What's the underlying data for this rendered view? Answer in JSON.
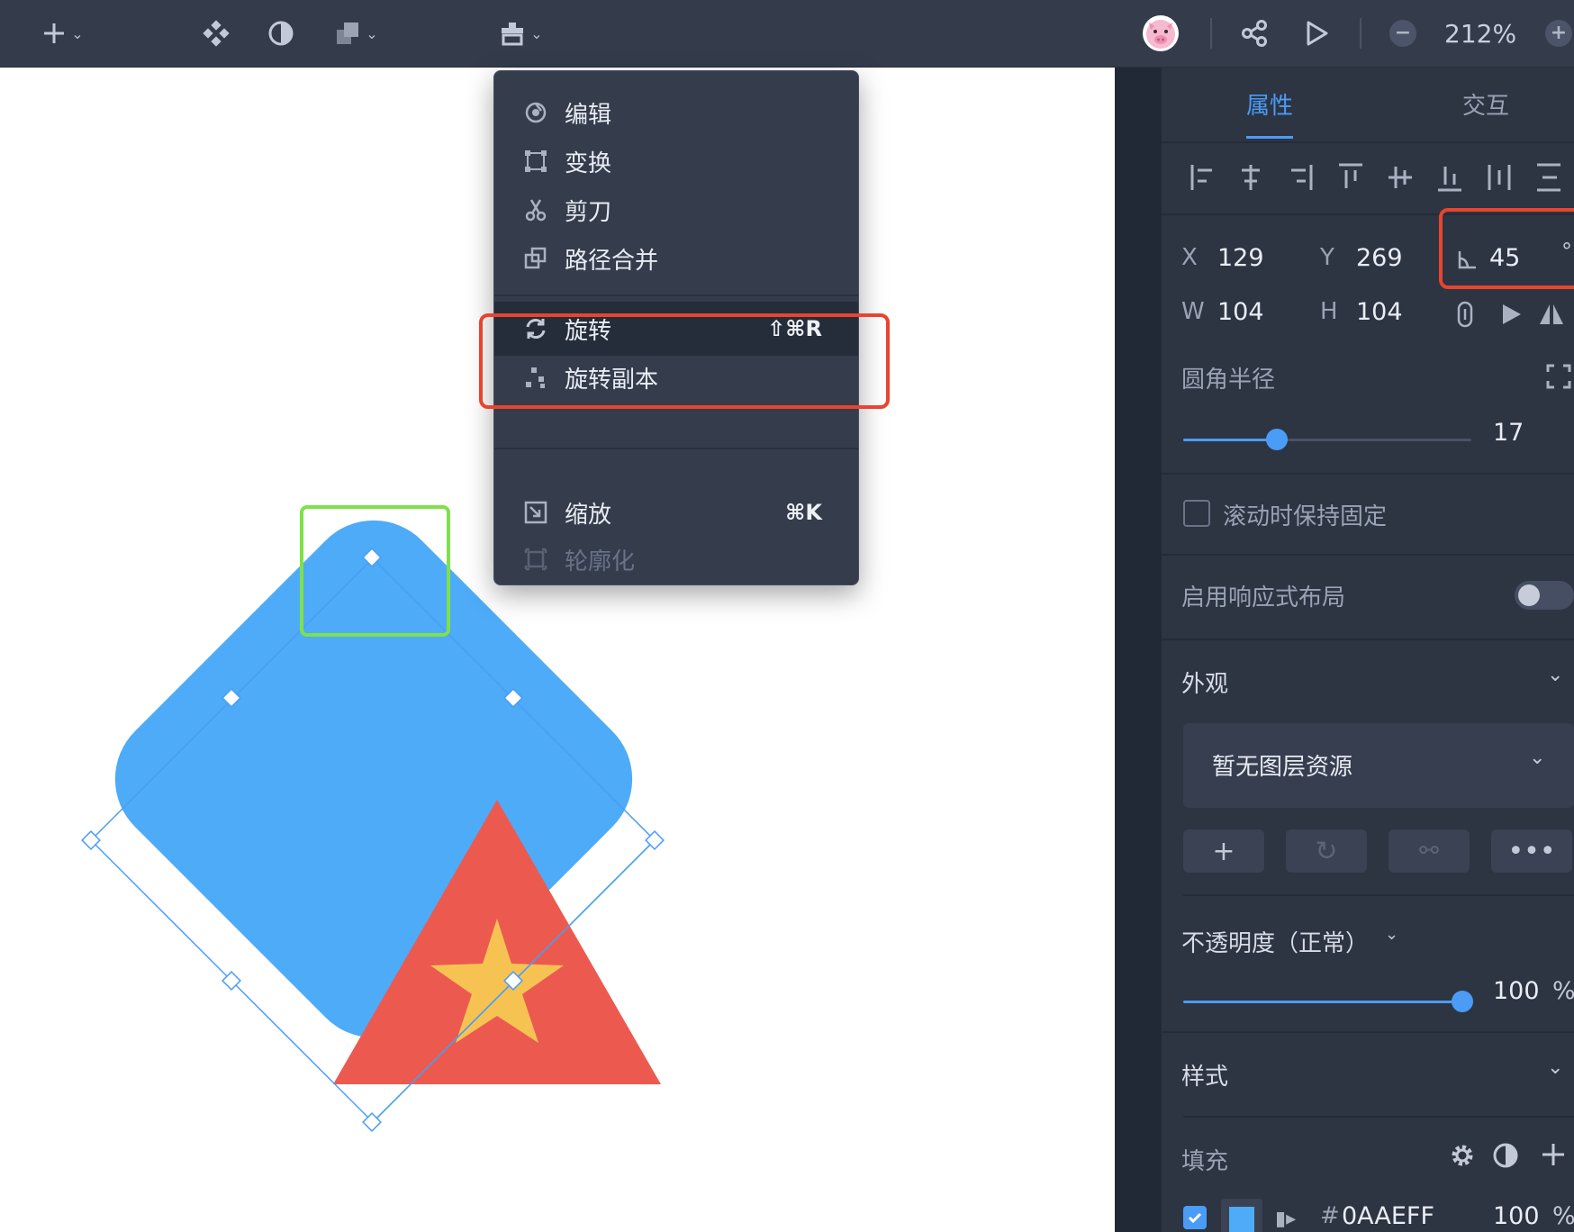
{
  "toolbar": {
    "add_icon": "plus-icon",
    "component_icon": "component-icon",
    "mask_icon": "half-circle-icon",
    "boolean_icon": "layers-icon",
    "path_tools_icon": "path-tools-icon",
    "avatar_icon": "pig-avatar",
    "share_icon": "share-icon",
    "play_icon": "play-icon",
    "zoom_out_label": "−",
    "zoom_level": "212%",
    "zoom_in_label": "+"
  },
  "context_menu": {
    "items": [
      {
        "label": "编辑",
        "icon": "edit-icon",
        "shortcut": "",
        "state": "normal"
      },
      {
        "label": "变换",
        "icon": "transform-icon",
        "shortcut": "",
        "state": "normal"
      },
      {
        "label": "剪刀",
        "icon": "scissors-icon",
        "shortcut": "",
        "state": "normal"
      },
      {
        "label": "路径合并",
        "icon": "path-merge-icon",
        "shortcut": "",
        "state": "normal"
      },
      {
        "label": "旋转",
        "icon": "rotate-icon",
        "shortcut": "⇧⌘R",
        "state": "active"
      },
      {
        "label": "旋转副本",
        "icon": "rotate-copy-icon",
        "shortcut": "",
        "state": "normal"
      },
      {
        "label": "缩放",
        "icon": "scale-icon",
        "shortcut": "⌘K",
        "state": "normal"
      },
      {
        "label": "轮廓化",
        "icon": "outline-icon",
        "shortcut": "",
        "state": "disabled"
      }
    ]
  },
  "panel": {
    "tabs": [
      {
        "label": "属性",
        "active": true
      },
      {
        "label": "交互",
        "active": false
      }
    ],
    "geometry": {
      "x_label": "X",
      "x_value": "129",
      "y_label": "Y",
      "y_value": "269",
      "rotation_value": "45",
      "rotation_unit": "°",
      "w_label": "W",
      "w_value": "104",
      "h_label": "H",
      "h_value": "104"
    },
    "corner_radius": {
      "label": "圆角半径",
      "value": "17",
      "level": 0.32
    },
    "fixed_on_scroll": {
      "label": "滚动时保持固定",
      "checked": false
    },
    "responsive_layout": {
      "label": "启用响应式布局",
      "enabled": false
    },
    "appearance": {
      "title": "外观",
      "layer_resource_select": "暂无图层资源",
      "opacity_label": "不透明度（正常）",
      "opacity_value": "100",
      "opacity_unit": "%",
      "opacity_level": 1.0
    },
    "style": {
      "title": "样式"
    },
    "fill": {
      "title": "填充",
      "checked": true,
      "hash": "#",
      "hex": "0AAEFF",
      "color": "#4dabf7",
      "opacity": "100",
      "unit": "%"
    }
  },
  "colors": {
    "accent": "#4a9cf6",
    "highlight": "#e8442f",
    "selection_green": "#7fe04a",
    "shape_blue": "#4dabf7",
    "shape_red": "#ec5a4f",
    "shape_star": "#f6c352"
  }
}
